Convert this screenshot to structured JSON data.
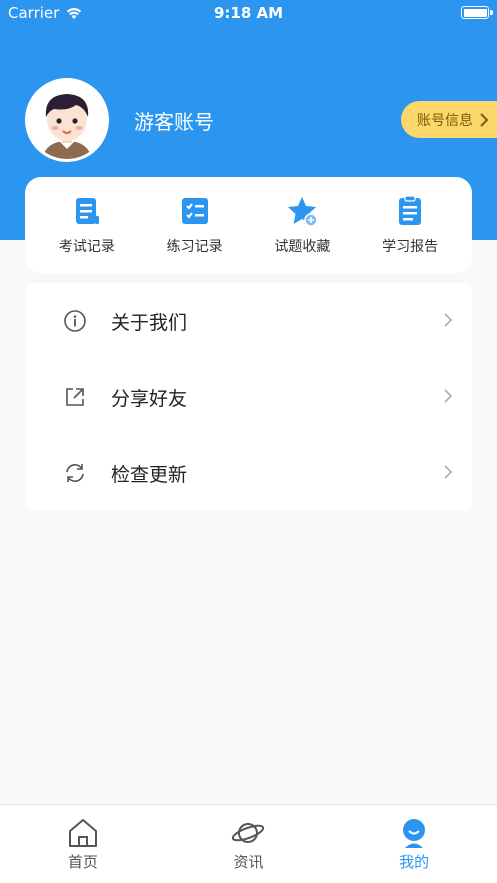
{
  "status_bar": {
    "carrier": "Carrier",
    "time": "9:18 AM"
  },
  "profile": {
    "username": "游客账号",
    "account_button": "账号信息"
  },
  "quick_actions": [
    {
      "label": "考试记录",
      "icon": "exam-record-icon"
    },
    {
      "label": "练习记录",
      "icon": "practice-record-icon"
    },
    {
      "label": "试题收藏",
      "icon": "favorite-star-icon"
    },
    {
      "label": "学习报告",
      "icon": "study-report-icon"
    }
  ],
  "menu": [
    {
      "label": "关于我们",
      "icon": "info-icon"
    },
    {
      "label": "分享好友",
      "icon": "share-icon"
    },
    {
      "label": "检查更新",
      "icon": "refresh-icon"
    }
  ],
  "tabs": [
    {
      "label": "首页",
      "icon": "home-icon",
      "active": false
    },
    {
      "label": "资讯",
      "icon": "planet-icon",
      "active": false
    },
    {
      "label": "我的",
      "icon": "profile-icon",
      "active": true
    }
  ],
  "colors": {
    "primary": "#2b95f0",
    "badge": "#fcd86a",
    "background": "#f7f8fa"
  }
}
